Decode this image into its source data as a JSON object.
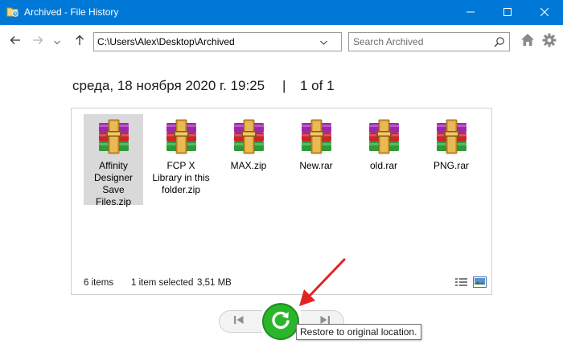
{
  "window": {
    "title": "Archived - File History",
    "controls": [
      "minimize-icon",
      "maximize-icon",
      "close-icon"
    ],
    "accent": "#0078d7"
  },
  "toolbar": {
    "back_icon": "arrow-left-icon",
    "forward_icon": "arrow-right-icon",
    "recent_icon": "chevron-down-icon",
    "up_icon": "arrow-up-icon",
    "address": "C:\\Users\\Alex\\Desktop\\Archived",
    "search_placeholder": "Search Archived",
    "home_icon": "home-icon",
    "settings_icon": "gear-icon"
  },
  "header": {
    "date": "среда, 18 ноября 2020 г. 19:25",
    "separator": "|",
    "page": "1 of 1"
  },
  "files": [
    {
      "name": "Affinity Designer Save Files.zip",
      "selected": true,
      "icon": "winrar-archive-icon"
    },
    {
      "name": "FCP X Library in this folder.zip",
      "selected": false,
      "icon": "winrar-archive-icon"
    },
    {
      "name": "MAX.zip",
      "selected": false,
      "icon": "winrar-archive-icon"
    },
    {
      "name": "New.rar",
      "selected": false,
      "icon": "winrar-archive-icon"
    },
    {
      "name": "old.rar",
      "selected": false,
      "icon": "winrar-archive-icon"
    },
    {
      "name": "PNG.rar",
      "selected": false,
      "icon": "winrar-archive-icon"
    }
  ],
  "status": {
    "items": "6 items",
    "selection": "1 item selected",
    "size": "3,51 MB"
  },
  "controls": {
    "previous_icon": "skip-previous-icon",
    "restore_icon": "restore-icon",
    "next_icon": "skip-next-icon",
    "tooltip": "Restore to original location.",
    "restore_color": "#2bb52b",
    "annotation_color": "#e02424"
  }
}
